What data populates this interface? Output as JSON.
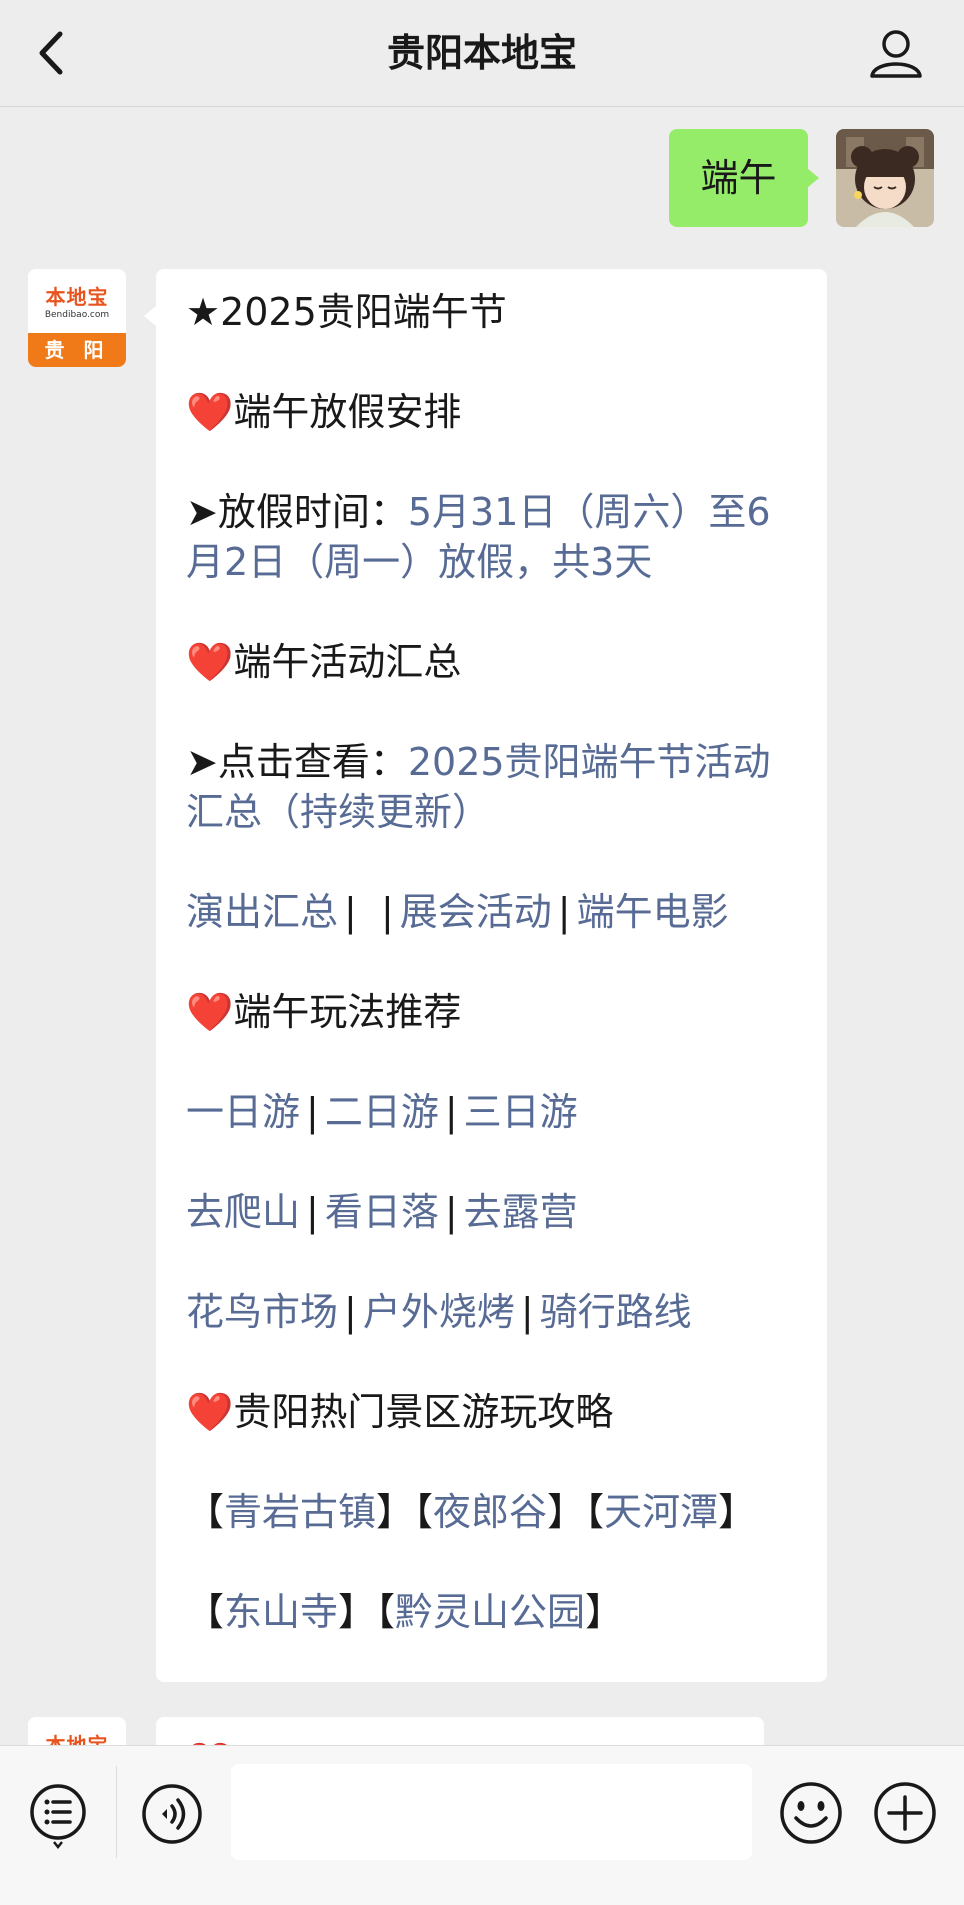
{
  "header": {
    "title": "贵阳本地宝"
  },
  "sent_message": {
    "text": "端午"
  },
  "bot_avatar": {
    "logo_name": "本地宝",
    "logo_url": "Bendibao.com",
    "city": "贵 阳"
  },
  "message": {
    "title": "★2025贵阳端午节",
    "sections": {
      "holiday_heading": "端午放假安排",
      "holiday_label": "➤放假时间：",
      "holiday_value": "5月31日（周六）至6月2日（周一）放假，共3天",
      "activity_heading": "端午活动汇总",
      "activity_label": "➤点击查看：",
      "activity_value": "2025贵阳端午节活动汇总（持续更新）",
      "activity_links": [
        "演出汇总",
        "展会活动",
        "端午电影"
      ],
      "play_heading": "端午玩法推荐",
      "trip_links": [
        "一日游",
        "二日游",
        "三日游"
      ],
      "outdoor_links": [
        "去爬山",
        "看日落",
        "去露营"
      ],
      "misc_links": [
        "花鸟市场",
        "户外烧烤",
        "骑行路线"
      ],
      "scenic_heading": "贵阳热门景区游玩攻略",
      "scenic_row1": [
        "青岩古镇",
        "夜郎谷",
        "天河潭"
      ],
      "scenic_row2": [
        "东山寺",
        "黔灵山公园"
      ]
    }
  },
  "colors": {
    "link": "#576b95",
    "sent_bubble": "#95ec69",
    "heart": "#e8202e",
    "brand_orange": "#f07a18"
  },
  "icons": {
    "back": "chevron-left-icon",
    "user": "user-profile-icon",
    "menu": "list-menu-icon",
    "voice": "voice-icon",
    "emoji": "emoji-icon",
    "plus": "plus-icon",
    "heart": "heart-icon"
  }
}
